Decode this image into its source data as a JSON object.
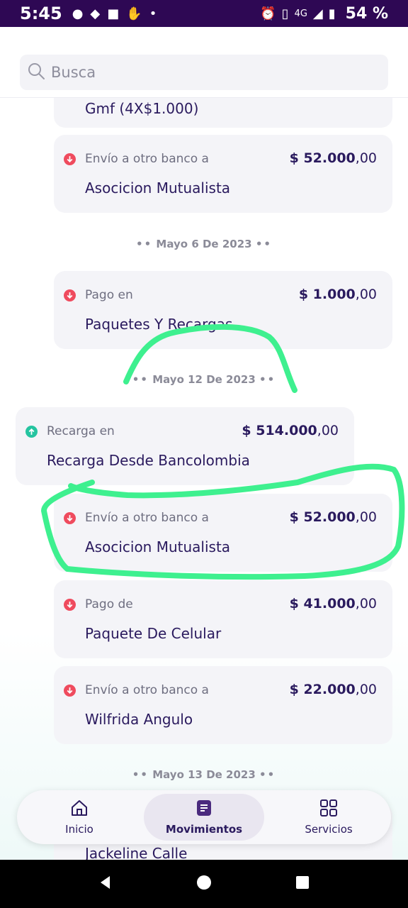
{
  "status_bar": {
    "time": "5:45",
    "network": "4G",
    "battery": "54 %"
  },
  "search": {
    "placeholder": "Busca"
  },
  "transactions": [
    {
      "type": "",
      "amount": "",
      "cents": "",
      "name": "Gmf (4X$1.000)",
      "direction": "out"
    },
    {
      "type": "Envío a otro banco a",
      "amount": "$ 52.000",
      "cents": ",00",
      "name": "Asocicion Mutualista",
      "direction": "out"
    },
    {
      "type": "Pago en",
      "amount": "$ 1.000",
      "cents": ",00",
      "name": "Paquetes Y Recargas",
      "direction": "out"
    },
    {
      "type": "Recarga en",
      "amount": "$ 514.000",
      "cents": ",00",
      "name": "Recarga Desde Bancolombia",
      "direction": "in"
    },
    {
      "type": "Envío a otro banco a",
      "amount": "$ 52.000",
      "cents": ",00",
      "name": "Asocicion Mutualista",
      "direction": "out"
    },
    {
      "type": "Pago de",
      "amount": "$ 41.000",
      "cents": ",00",
      "name": "Paquete De Celular",
      "direction": "out"
    },
    {
      "type": "Envío a otro banco a",
      "amount": "$ 22.000",
      "cents": ",00",
      "name": "Wilfrida Angulo",
      "direction": "out"
    },
    {
      "type": "",
      "amount": "",
      "cents": "",
      "name": "Jackeline Calle",
      "direction": "out"
    }
  ],
  "dates": [
    "Mayo 6 De 2023",
    "Mayo 12 De 2023",
    "Mayo 13 De 2023"
  ],
  "nav": {
    "inicio": "Inicio",
    "movimientos": "Movimientos",
    "servicios": "Servicios"
  },
  "colors": {
    "brand_dark": "#2e0854",
    "text_primary": "#2a1a5e",
    "outgoing": "#ef4b5e",
    "incoming": "#25c4a0",
    "highlight_marker": "#3ef08f"
  }
}
